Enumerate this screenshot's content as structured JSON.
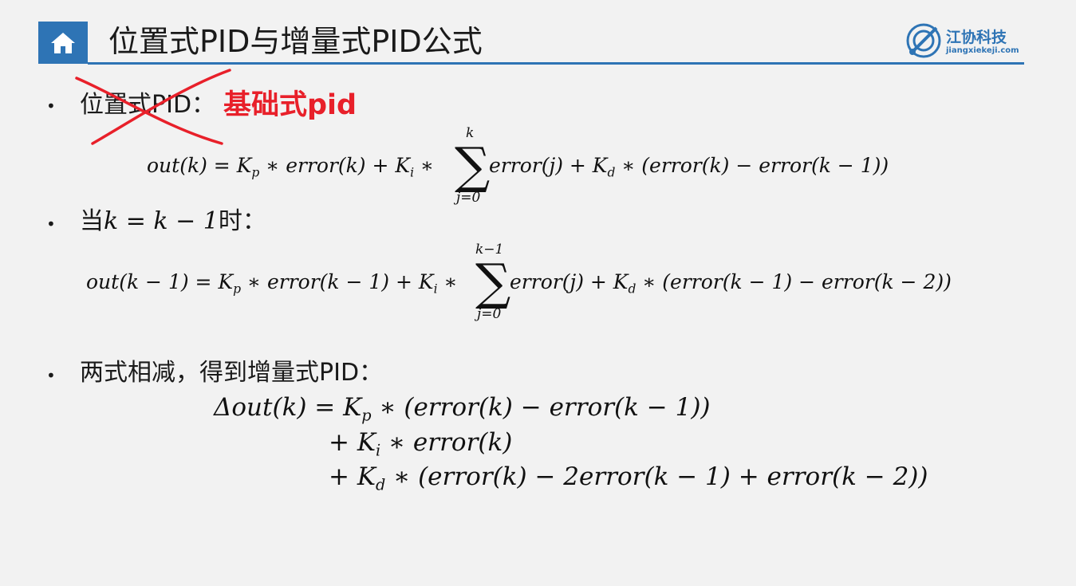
{
  "header": {
    "title": "位置式PID与增量式PID公式",
    "logo_cn": "江协科技",
    "logo_en": "jiangxiekeji.com"
  },
  "bullets": {
    "b1_label": "位置式PID：",
    "b1_annotation": "基础式pid",
    "b2_prefix": "当",
    "b2_math": "k = k − 1",
    "b2_suffix": "时：",
    "b3_label": "两式相减，得到增量式PID："
  },
  "formulas": {
    "f1_left": "out(k) = K",
    "f1_sub_p": "p",
    "f1_mid": " ∗ error(k) + K",
    "f1_sub_i": "i",
    "f1_star": " ∗",
    "f1_sum_upper": "k",
    "f1_sum_lower": "j=0",
    "f1_right": "error(j) + K",
    "f1_sub_d": "d",
    "f1_tail": " ∗ (error(k) − error(k − 1))",
    "f2_left": "out(k − 1) = K",
    "f2_sub_p": "p",
    "f2_mid": " ∗ error(k − 1) + K",
    "f2_sub_i": "i",
    "f2_star": " ∗",
    "f2_sum_upper": "k−1",
    "f2_sum_lower": "j=0",
    "f2_right": "error(j) + K",
    "f2_sub_d": "d",
    "f2_tail": " ∗ (error(k − 1) − error(k − 2))",
    "f3_line1": "Δout(k) = K",
    "f3_sub_p": "p",
    "f3_line1_tail": " ∗ (error(k) − error(k − 1))",
    "f3_line2": "+ K",
    "f3_sub_i": "i",
    "f3_line2_tail": " ∗ error(k)",
    "f3_line3": "+ K",
    "f3_sub_d": "d",
    "f3_line3_tail": " ∗ (error(k) − 2error(k − 1) + error(k − 2))"
  },
  "colors": {
    "accent": "#2e74b5",
    "annotation": "#e8202a"
  },
  "icons": [
    "home-icon",
    "logo-icon"
  ]
}
